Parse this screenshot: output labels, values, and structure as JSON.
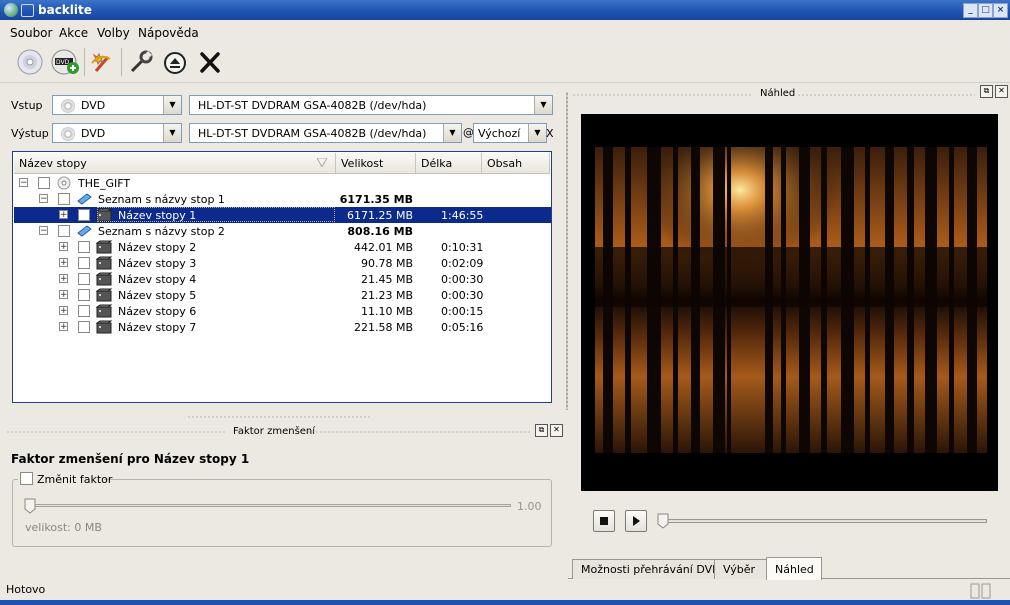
{
  "window": {
    "title": "backlite"
  },
  "menu": [
    {
      "label": "Soubor"
    },
    {
      "label": "Akce"
    },
    {
      "label": "Volby"
    },
    {
      "label": "Nápověda"
    }
  ],
  "toolbar": {
    "buttons": [
      {
        "icon": "disc-icon"
      },
      {
        "icon": "dvd-add-icon"
      },
      {
        "icon": "magic-wand-icon"
      },
      {
        "icon": "wrench-icon"
      },
      {
        "icon": "eject-icon"
      },
      {
        "icon": "x-tools-icon"
      }
    ]
  },
  "input": {
    "label": "Vstup",
    "type_value": "DVD",
    "device_value": "HL-DT-ST DVDRAM GSA-4082B  (/dev/hda)"
  },
  "output": {
    "label": "Výstup",
    "type_value": "DVD",
    "device_value": "HL-DT-ST DVDRAM GSA-4082B  (/dev/hda)",
    "at_sign": "@",
    "speed_value": "Výchozí",
    "trailing_x": "X"
  },
  "tree": {
    "columns": [
      "Název stopy",
      "Velikost",
      "Délka",
      "Obsah"
    ],
    "rows": [
      {
        "name": "THE_GIFT",
        "size": "",
        "length": "",
        "level": 0,
        "icon": "disc-icon",
        "bold_size": false,
        "selected": false,
        "expander": "−"
      },
      {
        "name": "Seznam s názvy stop 1",
        "size": "6171.35 MB",
        "length": "",
        "level": 1,
        "icon": "playlist-icon",
        "bold_size": true,
        "selected": false,
        "expander": "−"
      },
      {
        "name": "Název stopy 1",
        "size": "6171.25 MB",
        "length": "1:46:55",
        "level": 2,
        "icon": "video-clip-icon",
        "bold_size": false,
        "selected": true,
        "expander": "+"
      },
      {
        "name": "Seznam s názvy stop 2",
        "size": "808.16 MB",
        "length": "",
        "level": 1,
        "icon": "playlist-icon",
        "bold_size": true,
        "selected": false,
        "expander": "−"
      },
      {
        "name": "Název stopy 2",
        "size": "442.01 MB",
        "length": "0:10:31",
        "level": 2,
        "icon": "video-clip-icon",
        "bold_size": false,
        "selected": false,
        "expander": "+"
      },
      {
        "name": "Název stopy 3",
        "size": "90.78 MB",
        "length": "0:02:09",
        "level": 2,
        "icon": "video-clip-icon",
        "bold_size": false,
        "selected": false,
        "expander": "+"
      },
      {
        "name": "Název stopy 4",
        "size": "21.45 MB",
        "length": "0:00:30",
        "level": 2,
        "icon": "video-clip-icon",
        "bold_size": false,
        "selected": false,
        "expander": "+"
      },
      {
        "name": "Název stopy 5",
        "size": "21.23 MB",
        "length": "0:00:30",
        "level": 2,
        "icon": "video-clip-icon",
        "bold_size": false,
        "selected": false,
        "expander": "+"
      },
      {
        "name": "Název stopy 6",
        "size": "11.10 MB",
        "length": "0:00:15",
        "level": 2,
        "icon": "video-clip-icon",
        "bold_size": false,
        "selected": false,
        "expander": "+"
      },
      {
        "name": "Název stopy 7",
        "size": "221.58 MB",
        "length": "0:05:16",
        "level": 2,
        "icon": "video-clip-icon",
        "bold_size": false,
        "selected": false,
        "expander": "+"
      }
    ]
  },
  "factor_dock": {
    "title": "Faktor zmenšení",
    "heading": "Faktor zmenšení pro Název stopy 1",
    "checkbox_label": "Změnit faktor",
    "slider_value": "1.00",
    "size_text": "velikost: 0 MB"
  },
  "preview_dock": {
    "title": "Náhled"
  },
  "tabs": [
    {
      "label": "Možnosti přehrávání DVD",
      "active": false
    },
    {
      "label": "Výběr",
      "active": false
    },
    {
      "label": "Náhled",
      "active": true
    }
  ],
  "status": {
    "text": "Hotovo"
  },
  "colors": {
    "selection": "#0b2a8c",
    "titlebar": "#1f52b0"
  }
}
